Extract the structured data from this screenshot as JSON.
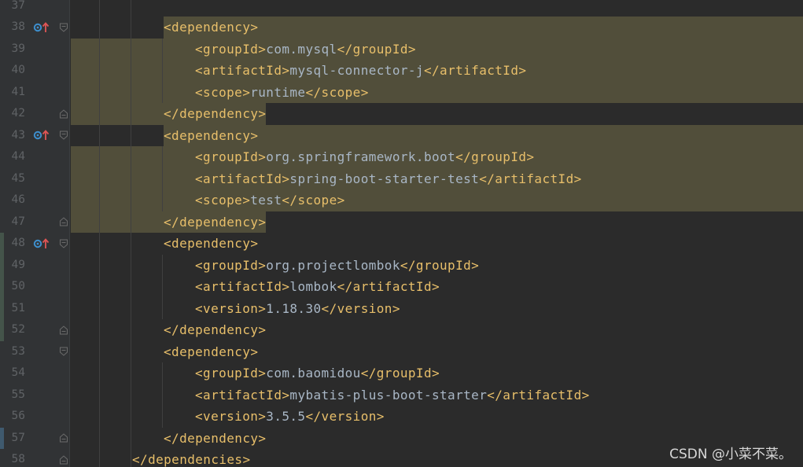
{
  "editor": {
    "colors": {
      "background": "#2b2b2b",
      "gutter": "#313335",
      "selection": "#514e3a",
      "tag": "#e8bf6a",
      "text": "#a9b7c6",
      "line_number": "#606366",
      "override_icon_blue": "#3d8fce",
      "override_icon_red": "#e05555"
    },
    "lines": [
      {
        "num": "37",
        "indent": 0,
        "open": "",
        "text": "",
        "close": ""
      },
      {
        "num": "38",
        "indent": 2,
        "open": "<dependency>",
        "text": "",
        "close": "",
        "icon": "override-up-icon",
        "fold": "fold-start"
      },
      {
        "num": "39",
        "indent": 3,
        "open": "<groupId>",
        "text": "com.mysql",
        "close": "</groupId>"
      },
      {
        "num": "40",
        "indent": 3,
        "open": "<artifactId>",
        "text": "mysql-connector-j",
        "close": "</artifactId>"
      },
      {
        "num": "41",
        "indent": 3,
        "open": "<scope>",
        "text": "runtime",
        "close": "</scope>"
      },
      {
        "num": "42",
        "indent": 2,
        "open": "",
        "text": "",
        "close": "</dependency>",
        "fold": "fold-end"
      },
      {
        "num": "43",
        "indent": 2,
        "open": "<dependency>",
        "text": "",
        "close": "",
        "icon": "override-up-icon",
        "fold": "fold-start"
      },
      {
        "num": "44",
        "indent": 3,
        "open": "<groupId>",
        "text": "org.springframework.boot",
        "close": "</groupId>"
      },
      {
        "num": "45",
        "indent": 3,
        "open": "<artifactId>",
        "text": "spring-boot-starter-test",
        "close": "</artifactId>"
      },
      {
        "num": "46",
        "indent": 3,
        "open": "<scope>",
        "text": "test",
        "close": "</scope>"
      },
      {
        "num": "47",
        "indent": 2,
        "open": "",
        "text": "",
        "close": "</dependency>",
        "fold": "fold-end"
      },
      {
        "num": "48",
        "indent": 2,
        "open": "<dependency>",
        "text": "",
        "close": "",
        "icon": "override-up-icon",
        "fold": "fold-start"
      },
      {
        "num": "49",
        "indent": 3,
        "open": "<groupId>",
        "text": "org.projectlombok",
        "close": "</groupId>"
      },
      {
        "num": "50",
        "indent": 3,
        "open": "<artifactId>",
        "text": "lombok",
        "close": "</artifactId>"
      },
      {
        "num": "51",
        "indent": 3,
        "open": "<version>",
        "text": "1.18.30",
        "close": "</version>"
      },
      {
        "num": "52",
        "indent": 2,
        "open": "",
        "text": "",
        "close": "</dependency>",
        "fold": "fold-end"
      },
      {
        "num": "53",
        "indent": 2,
        "open": "<dependency>",
        "text": "",
        "close": "",
        "fold": "fold-start"
      },
      {
        "num": "54",
        "indent": 3,
        "open": "<groupId>",
        "text": "com.baomidou",
        "close": "</groupId>"
      },
      {
        "num": "55",
        "indent": 3,
        "open": "<artifactId>",
        "text": "mybatis-plus-boot-starter",
        "close": "</artifactId>"
      },
      {
        "num": "56",
        "indent": 3,
        "open": "<version>",
        "text": "3.5.5",
        "close": "</version>"
      },
      {
        "num": "57",
        "indent": 2,
        "open": "",
        "text": "",
        "close": "</dependency>",
        "fold": "fold-end"
      },
      {
        "num": "58",
        "indent": 1,
        "open": "",
        "text": "",
        "close": "</dependencies>",
        "fold": "fold-end"
      }
    ]
  },
  "watermark": "CSDN @小菜不菜。"
}
